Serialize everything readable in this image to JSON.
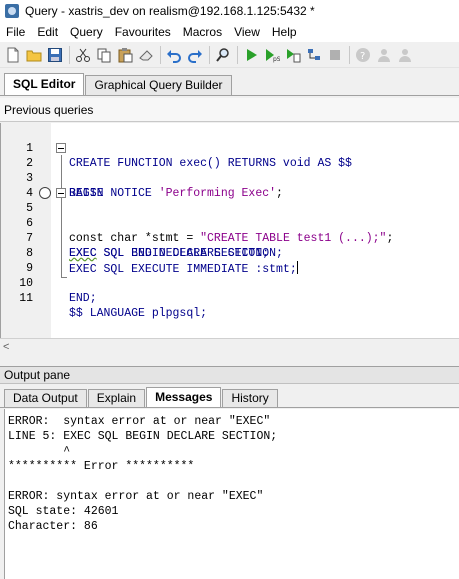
{
  "window": {
    "title": "Query - xastris_dev on realism@192.168.1.125:5432 *"
  },
  "menu": [
    "File",
    "Edit",
    "Query",
    "Favourites",
    "Macros",
    "View",
    "Help"
  ],
  "toolbar": {
    "icons": [
      "new-file-icon",
      "open-folder-icon",
      "save-icon",
      "cut-icon",
      "copy-icon",
      "paste-icon",
      "clear-icon",
      "undo-icon",
      "redo-icon",
      "find-icon",
      "execute-icon",
      "execute-pgscript-icon",
      "execute-to-file-icon",
      "explain-icon",
      "stop-icon",
      "help-icon",
      "user-icon",
      "user-alt-icon"
    ]
  },
  "editor_tabs": [
    "SQL Editor",
    "Graphical Query Builder"
  ],
  "previous_queries_label": "Previous queries",
  "code_lines": [
    {
      "n": "1",
      "text": "CREATE FUNCTION exec() RETURNS void AS $$"
    },
    {
      "n": "2",
      "text": "BEGIN"
    },
    {
      "n": "3",
      "pre": "RAISE NOTICE ",
      "str": "'Performing Exec'",
      "post": ";"
    },
    {
      "n": "4",
      "text": ""
    },
    {
      "n": "5",
      "squig": "EXEC",
      "text": " SQL BEGIN DECLARE SECTION;"
    },
    {
      "n": "6",
      "pre": "const char *stmt = ",
      "str": "\"CREATE TABLE test1 (...);\"",
      "post": ";"
    },
    {
      "n": "7",
      "text": "EXEC SQL END DECLARE SECTION;"
    },
    {
      "n": "8",
      "text": "EXEC SQL EXECUTE IMMEDIATE :stmt;"
    },
    {
      "n": "9",
      "text": ""
    },
    {
      "n": "10",
      "text": "END;"
    },
    {
      "n": "11",
      "text": "$$ LANGUAGE plpgsql;"
    }
  ],
  "output_pane_label": "Output pane",
  "output_tabs": [
    "Data Output",
    "Explain",
    "Messages",
    "History"
  ],
  "messages": [
    "ERROR:  syntax error at or near \"EXEC\"",
    "LINE 5: EXEC SQL BEGIN DECLARE SECTION;",
    "        ^",
    "********** Error **********",
    "",
    "ERROR: syntax error at or near \"EXEC\"",
    "SQL state: 42601",
    "Character: 86"
  ],
  "colors": {
    "keyword": "#00008b",
    "string": "#8b008b"
  }
}
